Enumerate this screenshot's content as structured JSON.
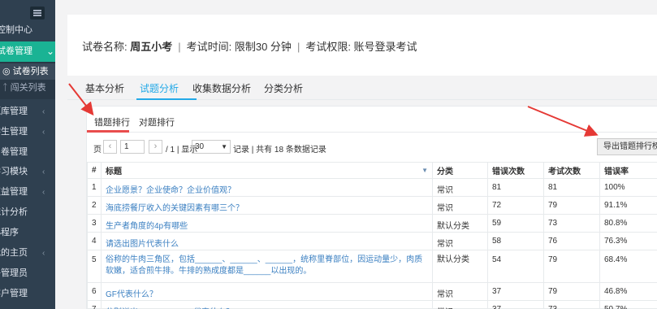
{
  "sidebar": {
    "items": [
      {
        "label": "控制中心",
        "chevron": ""
      },
      {
        "label": "试卷管理",
        "chevron": "⌄",
        "active": true
      },
      {
        "label": "题库管理",
        "chevron": "‹"
      },
      {
        "label": "学生管理",
        "chevron": "‹"
      },
      {
        "label": "问卷管理",
        "chevron": ""
      },
      {
        "label": "学习模块",
        "chevron": "‹"
      },
      {
        "label": "权益管理",
        "chevron": "‹"
      },
      {
        "label": "统计分析",
        "chevron": ""
      },
      {
        "label": "小程序",
        "chevron": ""
      },
      {
        "label": "我的主页",
        "chevron": "‹"
      },
      {
        "label": "子管理员",
        "chevron": ""
      },
      {
        "label": "客户管理",
        "chevron": ""
      }
    ],
    "sub_items": [
      {
        "label": "◎ 试卷列表"
      },
      {
        "label": "ᛏ 闯关列表"
      }
    ]
  },
  "exam_info": {
    "name_label": "试卷名称: ",
    "name_value": "周五小考",
    "sep": "|",
    "time_text": "考试时间: 限制30 分钟",
    "perm_text": "考试权限: 账号登录考试"
  },
  "tabs": [
    "基本分析",
    "试题分析",
    "收集数据分析",
    "分类分析"
  ],
  "subtabs": [
    "错题排行",
    "对题排行"
  ],
  "pager": {
    "page_label": "页",
    "prev": "‹",
    "page_value": "1",
    "next": "›",
    "total_pages": "/ 1 | 显示",
    "page_size": "30",
    "records": "记录 | 共有 18 条数据记录"
  },
  "export_button": "导出错题排行榜",
  "table": {
    "headers": [
      "#",
      "标题",
      "分类",
      "错误次数",
      "考试次数",
      "错误率"
    ],
    "rows": [
      [
        "1",
        "企业愿景？企业使命？企业价值观？",
        "常识",
        "81",
        "81",
        "100%"
      ],
      [
        "2",
        "海底捞餐厅收入的关键因素有哪三个？",
        "常识",
        "72",
        "79",
        "91.1%"
      ],
      [
        "3",
        "生产者角度的4p有哪些",
        "默认分类",
        "59",
        "73",
        "80.8%"
      ],
      [
        "4",
        "请选出图片代表什么",
        "常识",
        "58",
        "76",
        "76.3%"
      ],
      [
        "5",
        "俗称的牛肉三角区，包括______、______、______，统称里脊部位，因运动量少，肉质软嫩，适合煎牛排。牛排的熟成度都是______以出现的。",
        "默认分类",
        "54",
        "79",
        "68.4%"
      ],
      [
        "6",
        "GF代表什么？",
        "常识",
        "37",
        "79",
        "46.8%"
      ],
      [
        "7",
        "分别说出IW,MW,LP,VAC代表什么？",
        "常识",
        "37",
        "73",
        "50.7%"
      ]
    ]
  },
  "colors": {
    "sidebar": "#2f4050",
    "active": "#1ab394",
    "link": "#3a7fc1",
    "tab_active": "#23a9e7",
    "annotation": "#e53935"
  },
  "icons": {
    "menu": "hamburger-icon",
    "sort": "sort-down-icon"
  }
}
